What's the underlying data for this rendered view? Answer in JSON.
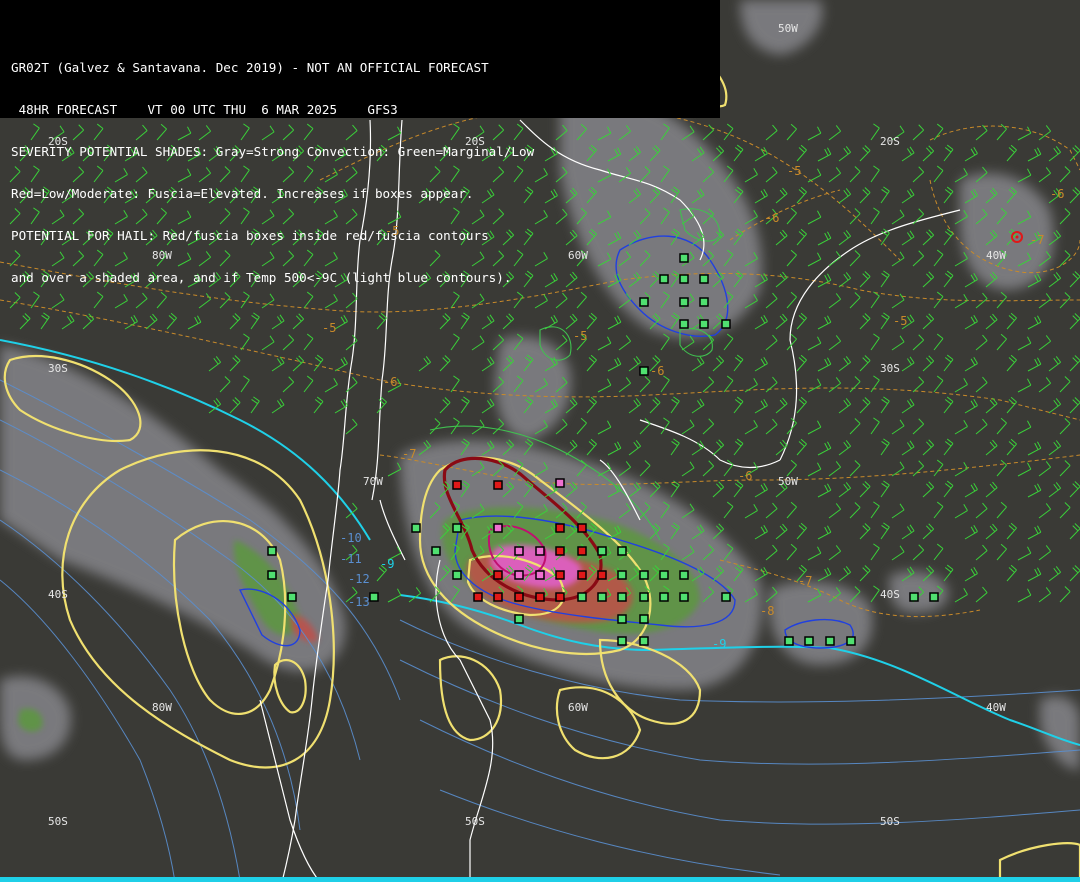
{
  "header": {
    "lines": [
      "GR02T (Galvez & Santavana. Dec 2019) - NOT AN OFFICIAL FORECAST",
      " 48HR FORECAST    VT 00 UTC THU  6 MAR 2025    GFS3",
      "SEVERITY POTENTIAL SHADES: Gray=Strong Convection: Green=Marginal/Low",
      "Red=Low/Moderate: Fuscia=Elevated. Increases if boxes appear.",
      "POTENTIAL FOR HAIL: Red/fuscia boxes inside red/fuscia contours",
      "and over a shaded area, and if Temp 500<-9C (light blue contours)."
    ]
  },
  "grid_labels": {
    "lat_20s_a": "20S",
    "lat_20s_b": "20S",
    "lat_20s_c": "20S",
    "lat_30s_a": "30S",
    "lat_30s_b": "30S",
    "lat_40s_a": "40S",
    "lat_40s_b": "40S",
    "lat_50s_a": "50S",
    "lat_50s_b": "50S",
    "lat_50s_c": "50S",
    "lon_80w_a": "80W",
    "lon_80w_b": "80W",
    "lon_70w": "70W",
    "lon_60w_a": "60W",
    "lon_60w_b": "60W",
    "lon_50w_a": "50W",
    "lon_50w_b": "50W",
    "lon_40w_a": "40W",
    "lon_40w_b": "40W"
  },
  "contour_labels": {
    "t_m5_a": "-5",
    "t_m5_b": "-5",
    "t_m5_c": "-5",
    "t_m5_d": "-5",
    "t_m5_e": "-5",
    "t_m6_a": "-6",
    "t_m6_b": "-6",
    "t_m6_c": "-6",
    "t_m6_d": "-6",
    "t_m6_e": "-6",
    "t_m7_a": "-7",
    "t_m7_b": "-7",
    "t_m7_c": "-7",
    "t_m8": "-8",
    "t_m9_a": "-9",
    "t_m9_b": "-9",
    "t_m10": "-10",
    "t_m11": "-11",
    "t_m12": "-12",
    "t_m13": "-13"
  },
  "colors": {
    "background": "#3a3a36",
    "header_bg": "#000000",
    "shade_gray": "#85858a",
    "shade_green": "#5a9a3a",
    "shade_red": "#c0504a",
    "shade_fuscia": "#e060c8",
    "temp_contour_orange": "#c88a2a",
    "minus9_contour_cyan": "#1fd0e8",
    "yellow_contour": "#f0e070",
    "blue_contour": "#2040e0",
    "hail_contour_darkred": "#8a0a14",
    "box_green": "#50e070",
    "box_red": "#e01818",
    "box_pink": "#f070d0",
    "coastline": "#ffffff",
    "wind_green": "#3ad03a",
    "wind_white": "#d8d8d8"
  }
}
